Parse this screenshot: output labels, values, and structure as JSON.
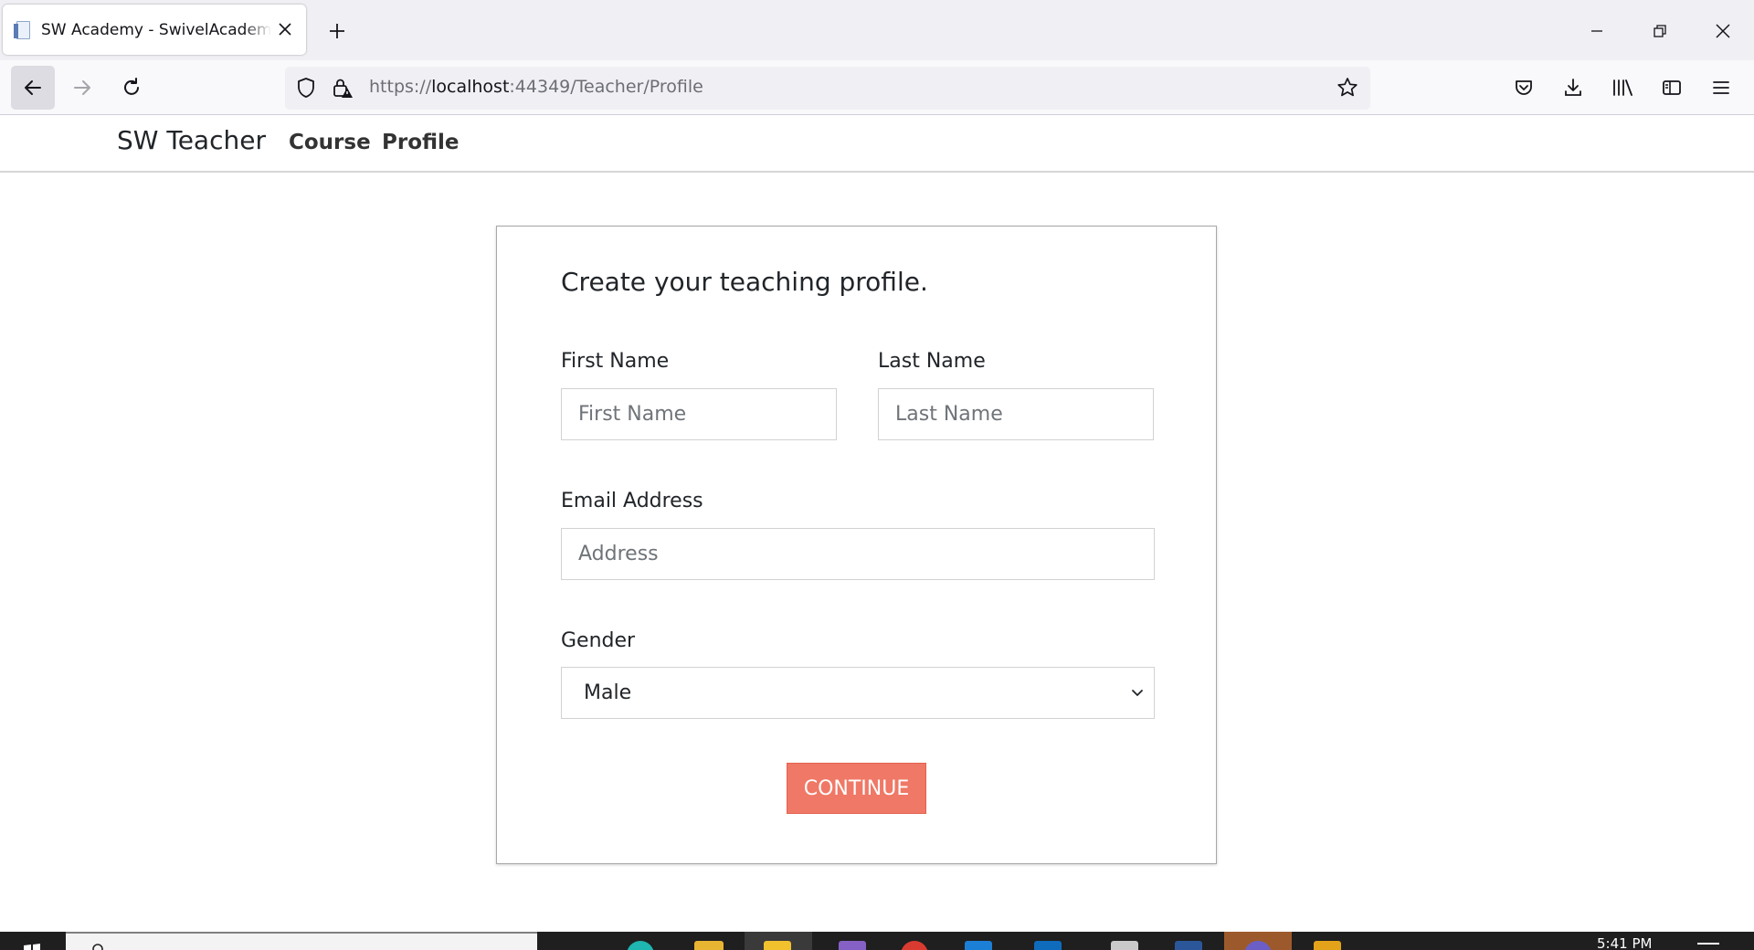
{
  "browser": {
    "tab_title": "SW Academy - SwivelAcademyWeb",
    "favicon_icon": "page-favicon-icon",
    "url_scheme": "https://",
    "url_host": "localhost",
    "url_rest": ":44349/Teacher/Profile"
  },
  "site": {
    "brand": "SW Teacher",
    "nav": [
      {
        "label": "Course"
      },
      {
        "label": "Profile"
      }
    ]
  },
  "form": {
    "title": "Create your teaching profile.",
    "first_name_label": "First Name",
    "first_name_placeholder": "First Name",
    "last_name_label": "Last Name",
    "last_name_placeholder": "Last Name",
    "email_label": "Email Address",
    "email_placeholder": "Address",
    "gender_label": "Gender",
    "gender_value": "Male",
    "submit_label": "CONTINUE"
  },
  "taskbar": {
    "clock_time": "5:41 PM"
  },
  "colors": {
    "accent": "#f07866",
    "browser_chrome": "#f0f0f4",
    "taskbar": "#1f1f1f"
  }
}
